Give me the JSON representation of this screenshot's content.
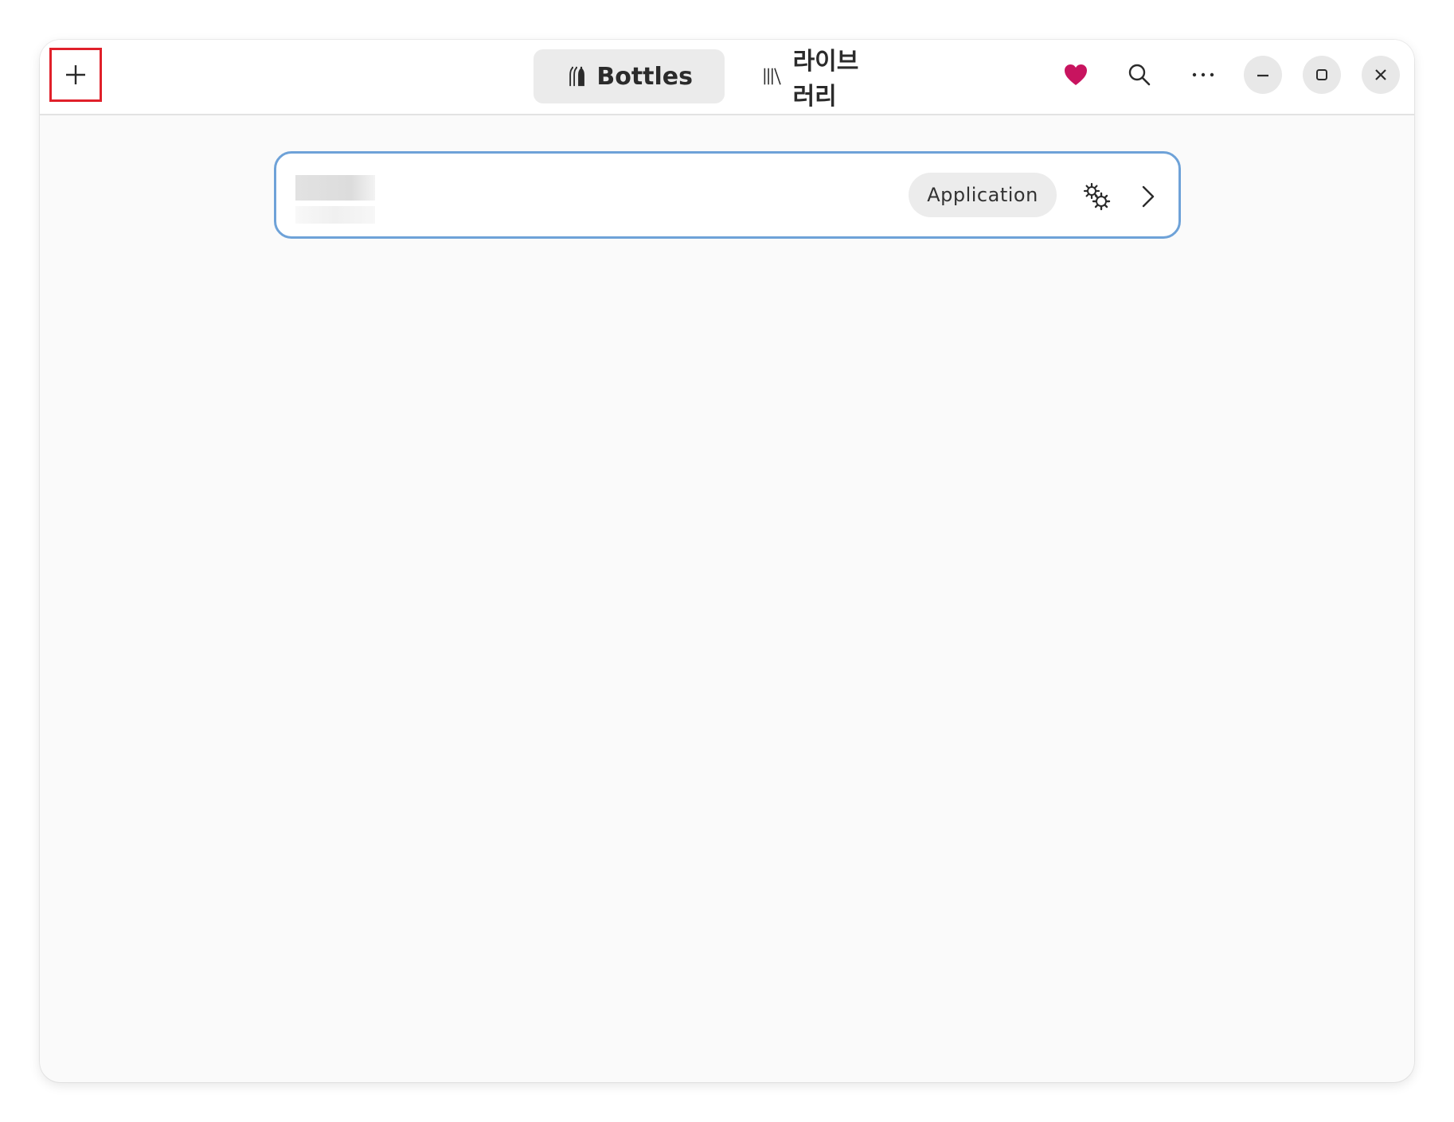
{
  "header": {
    "tabs": [
      {
        "label": "Bottles",
        "icon": "bottles-icon",
        "active": true
      },
      {
        "label": "라이브러리",
        "icon": "library-icon",
        "active": false
      }
    ],
    "icons": [
      "add-icon",
      "heart-icon",
      "search-icon",
      "more-icon",
      "minimize-icon",
      "maximize-icon",
      "close-icon"
    ],
    "heart_color": "#c8145f"
  },
  "bottles": [
    {
      "name": "",
      "subtitle": "",
      "environment": "Application"
    }
  ],
  "colors": {
    "accent_border": "#6ea2d8",
    "highlight_box": "#e0202a"
  }
}
